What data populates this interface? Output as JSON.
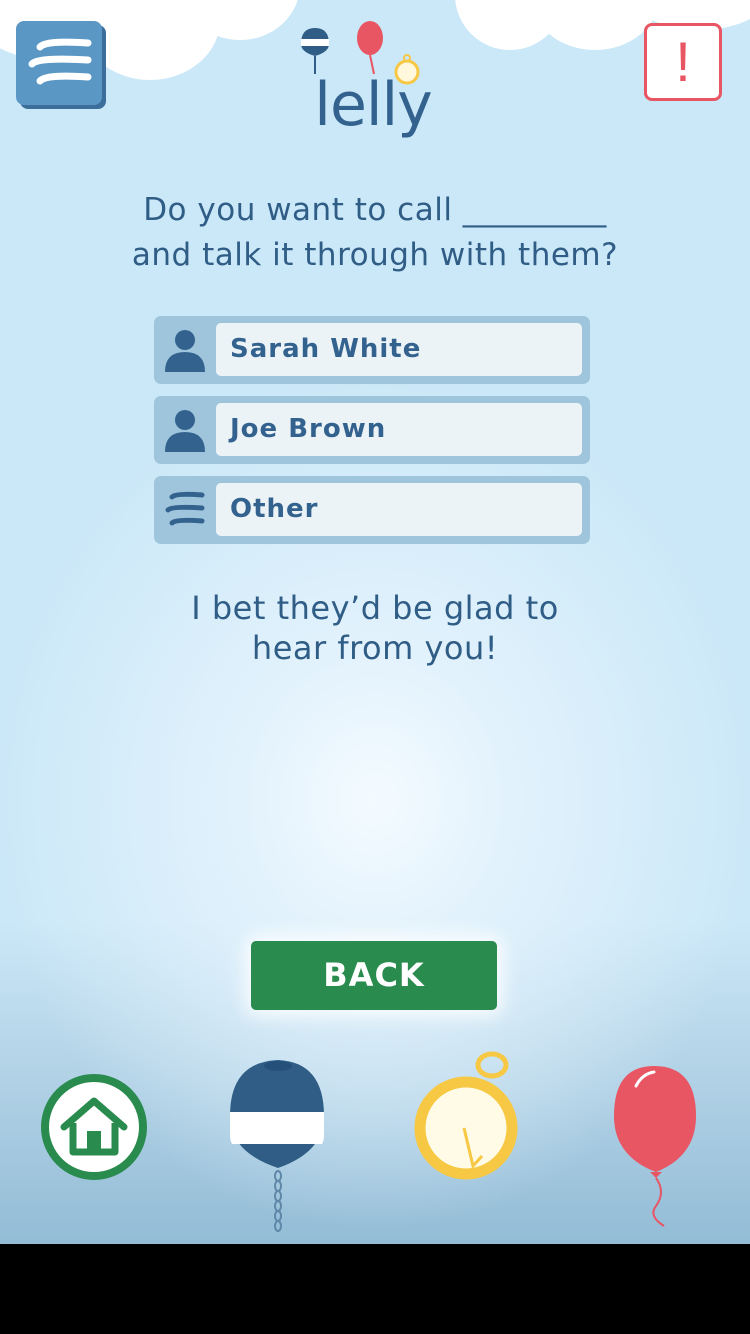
{
  "app": {
    "logo_text": "lelly"
  },
  "header": {
    "alert_label": "!"
  },
  "prompt": {
    "line1": "Do you want to call _________",
    "line2": "and talk it through with them?"
  },
  "contacts": [
    {
      "name": "Sarah White",
      "icon": "person-icon"
    },
    {
      "name": "Joe Brown",
      "icon": "person-icon"
    },
    {
      "name": "Other",
      "icon": "list-icon"
    }
  ],
  "encouragement": {
    "line1": "I bet they’d be glad to",
    "line2": "hear from you!"
  },
  "back_label": "BACK",
  "bottom_nav": [
    {
      "icon": "home-icon"
    },
    {
      "icon": "buoy-icon"
    },
    {
      "icon": "stopwatch-icon"
    },
    {
      "icon": "balloon-icon"
    }
  ],
  "colors": {
    "background": "#cbe8f8",
    "primary_text": "#2f5d86",
    "accent_green": "#2a8b4f",
    "alert_red": "#e85563",
    "menu_blue": "#5a97c4",
    "field_bg": "#ecf3f7",
    "row_bg": "#9ec5db",
    "gold": "#f7c844"
  }
}
